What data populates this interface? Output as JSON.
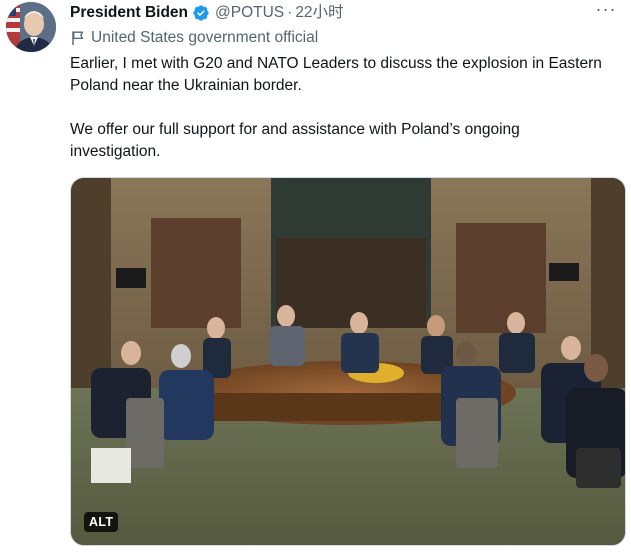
{
  "author": {
    "display_name": "President Biden",
    "handle": "@POTUS",
    "separator": "·",
    "timestamp": "22小时",
    "verified_icon": "verified-badge-icon",
    "label_icon": "flag-icon",
    "label": "United States government official"
  },
  "tweet": {
    "paragraphs": [
      "Earlier, I met with G20 and NATO Leaders to discuss the explosion in Eastern Poland near the Ukrainian border.",
      "We offer our full support for and assistance with Poland’s ongoing investigation."
    ]
  },
  "media": {
    "alt_badge": "ALT"
  },
  "menu": {
    "more_icon": "more-options-icon",
    "more_label": "···"
  },
  "colors": {
    "verified_blue": "#1d9bf0",
    "secondary_text": "#536471",
    "primary_text": "#0f1419"
  }
}
